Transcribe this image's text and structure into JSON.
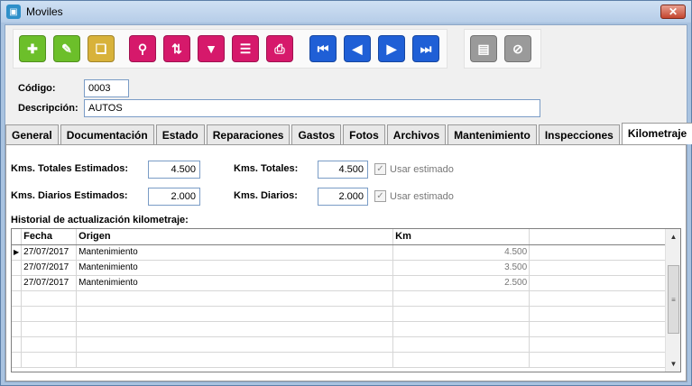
{
  "window": {
    "title": "Moviles",
    "close_label": "✕"
  },
  "form": {
    "codigo_label": "Código:",
    "codigo_value": "0003",
    "descripcion_label": "Descripción:",
    "descripcion_value": "AUTOS"
  },
  "tabs": [
    {
      "label": "General"
    },
    {
      "label": "Documentación"
    },
    {
      "label": "Estado"
    },
    {
      "label": "Reparaciones"
    },
    {
      "label": "Gastos"
    },
    {
      "label": "Fotos"
    },
    {
      "label": "Archivos"
    },
    {
      "label": "Mantenimiento"
    },
    {
      "label": "Inspecciones"
    },
    {
      "label": "Kilometraje"
    }
  ],
  "kilometraje": {
    "totales_est_label": "Kms. Totales Estimados:",
    "totales_est_value": "4.500",
    "diarios_est_label": "Kms. Diarios Estimados:",
    "diarios_est_value": "2.000",
    "totales_label": "Kms. Totales:",
    "totales_value": "4.500",
    "diarios_label": "Kms. Diarios:",
    "diarios_value": "2.000",
    "usar_estimado_label": "Usar estimado",
    "historial_label": "Historial de actualización kilometraje:"
  },
  "grid": {
    "columns": [
      "Fecha",
      "Origen",
      "Km"
    ],
    "rows": [
      [
        "27/07/2017",
        "Mantenimiento",
        "4.500"
      ],
      [
        "27/07/2017",
        "Mantenimiento",
        "3.500"
      ],
      [
        "27/07/2017",
        "Mantenimiento",
        "2.500"
      ]
    ]
  },
  "toolbar": {
    "icons": [
      "add-icon",
      "edit-icon",
      "copy-icon",
      "search-icon",
      "sort-az-icon",
      "filter-icon",
      "report-icon",
      "print-icon",
      "first-icon",
      "prev-icon",
      "next-icon",
      "last-icon",
      "save-icon",
      "cancel-icon"
    ]
  },
  "colors": {
    "green": "#6cbf2a",
    "pink": "#d6196b",
    "blue": "#1f5fd6",
    "gray": "#9a9a9a"
  }
}
